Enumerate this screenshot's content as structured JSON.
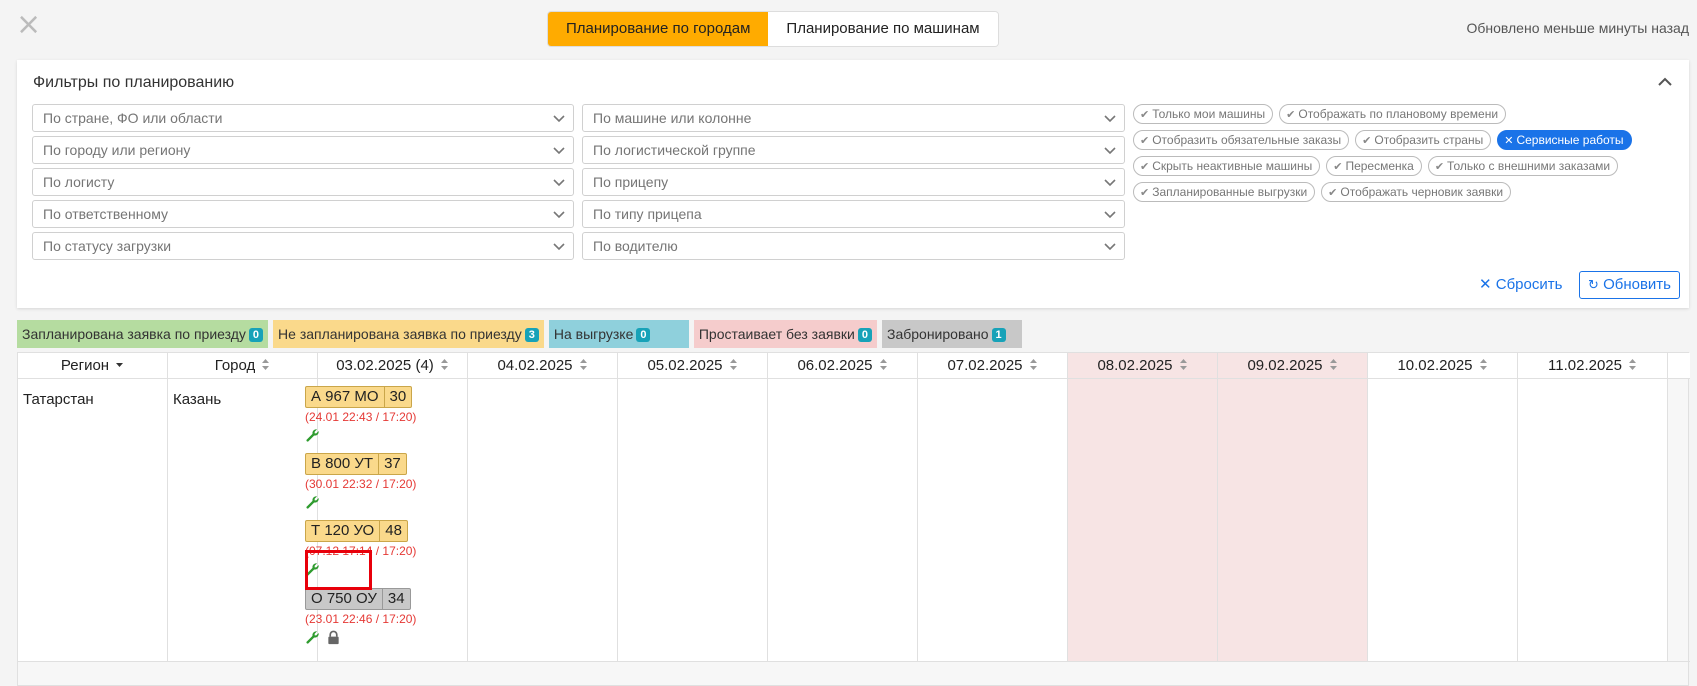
{
  "header": {
    "close_icon": "close-icon",
    "tabs": [
      {
        "label": "Планирование по городам",
        "active": true
      },
      {
        "label": "Планирование по машинам",
        "active": false
      }
    ],
    "updated_text": "Обновлено меньше минуты назад"
  },
  "filters": {
    "title": "Фильтры по планированию",
    "left": [
      {
        "placeholder": "По стране, ФО или области"
      },
      {
        "placeholder": "По городу или региону"
      },
      {
        "placeholder": "По логисту"
      },
      {
        "placeholder": "По ответственному"
      },
      {
        "placeholder": "По статусу загрузки"
      }
    ],
    "right": [
      {
        "placeholder": "По машине или колонне"
      },
      {
        "placeholder": "По логистической группе"
      },
      {
        "placeholder": "По прицепу"
      },
      {
        "placeholder": "По типу прицепа"
      },
      {
        "placeholder": "По водителю"
      }
    ],
    "chips": [
      [
        {
          "label": "Только мои машины",
          "active": false
        },
        {
          "label": "Отображать по плановому времени",
          "active": false
        }
      ],
      [
        {
          "label": "Отобразить обязательные заказы",
          "active": false
        },
        {
          "label": "Отобразить страны",
          "active": false
        },
        {
          "label": "Сервисные работы",
          "active": true
        }
      ],
      [
        {
          "label": "Скрыть неактивные машины",
          "active": false
        },
        {
          "label": "Пересменка",
          "active": false
        },
        {
          "label": "Только с внешними заказами",
          "active": false
        }
      ],
      [
        {
          "label": "Запланированные выгрузки",
          "active": false
        },
        {
          "label": "Отображать черновик заявки",
          "active": false
        }
      ]
    ],
    "reset_label": "Сбросить",
    "refresh_label": "Обновить"
  },
  "legend": [
    {
      "label": "Запланирована заявка по приезду",
      "count": "0",
      "color": "#b5dca0"
    },
    {
      "label": "Не запланирована заявка по приезду",
      "count": "3",
      "color": "#fad98b"
    },
    {
      "label": "На выгрузке",
      "count": "0",
      "color": "#8fd0dc"
    },
    {
      "label": "Простаивает без заявки",
      "count": "0",
      "color": "#f5cccc"
    },
    {
      "label": "Забронировано",
      "count": "1",
      "color": "#c8c8c8"
    }
  ],
  "table": {
    "columns": [
      "Регион",
      "Город",
      "03.02.2025 (4)",
      "04.02.2025",
      "05.02.2025",
      "06.02.2025",
      "07.02.2025",
      "08.02.2025",
      "09.02.2025",
      "10.02.2025",
      "11.02.2025"
    ],
    "row": {
      "region": "Татарстан",
      "city": "Казань",
      "trucks": [
        {
          "plate": "А 967 МО",
          "capacity": "30",
          "time": "(24.01 22:43 / 17:20)",
          "status": "yellow",
          "icons": [
            "wrench-icon"
          ]
        },
        {
          "plate": "В 800 УТ",
          "capacity": "37",
          "time": "(30.01 22:32 / 17:20)",
          "status": "yellow",
          "icons": [
            "wrench-icon"
          ]
        },
        {
          "plate": "Т 120 УО",
          "capacity": "48",
          "time": "(07.12 17:14 / 17:20)",
          "status": "yellow",
          "icons": [
            "wrench-icon"
          ]
        },
        {
          "plate": "О 750 ОУ",
          "capacity": "34",
          "time": "(23.01 22:46 / 17:20)",
          "status": "gray",
          "icons": [
            "wrench-icon",
            "lock-icon"
          ]
        }
      ]
    }
  },
  "colors": {
    "accent": "#ffab00",
    "link": "#1a73e8",
    "weekend": "#f7e4e4",
    "time_text": "#e53935",
    "wrench": "#2e9b2e"
  }
}
